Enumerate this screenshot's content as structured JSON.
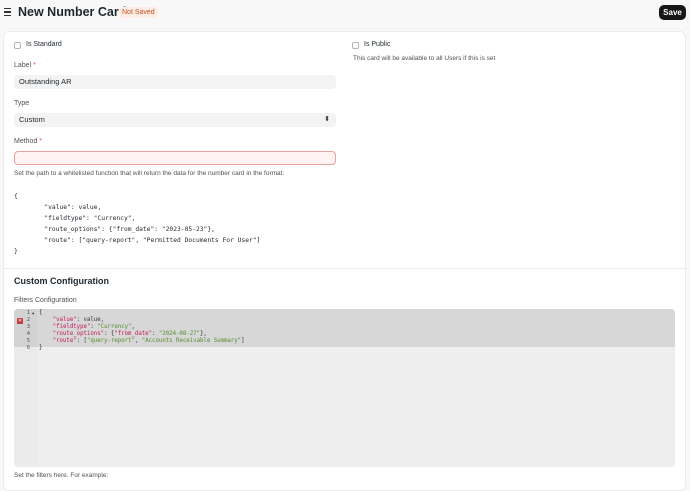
{
  "header": {
    "title": "New Number Card",
    "status_badge": "Not Saved",
    "save_label": "Save"
  },
  "form": {
    "is_standard_label": "Is Standard",
    "is_public_label": "Is Public",
    "is_public_help": "This card will be available to all Users if this is set",
    "label_label": "Label",
    "label_value": "Outstanding AR",
    "type_label": "Type",
    "type_value": "Custom",
    "method_label": "Method",
    "method_value": "",
    "method_help": "Set the path to a whitelisted function that will return the data for the number card in the format:",
    "method_example": "{\n        \"value\": value,\n        \"fieldtype\": \"Currency\",\n        \"route_options\": {\"from_date\": \"2023-05-23\"},\n        \"route\": [\"query-report\", \"Permitted Documents For User\"]\n}"
  },
  "custom_config": {
    "section_title": "Custom Configuration",
    "filters_label": "Filters Configuration",
    "editor_lines": [
      {
        "no": "1",
        "text": "{"
      },
      {
        "no": "2",
        "key": "\"value\"",
        "rest": ": value,"
      },
      {
        "no": "3",
        "key": "\"fieldtype\"",
        "rest": ": ",
        "str": "\"Currency\"",
        "tail": ","
      },
      {
        "no": "4",
        "key": "\"route_options\"",
        "rest": ": {",
        "key2": "\"from_date\"",
        "rest2": ": ",
        "str": "\"2024-08-27\"",
        "tail": "},"
      },
      {
        "no": "5",
        "key": "\"route\"",
        "rest": ": [",
        "str": "\"query-report\"",
        "mid": ", ",
        "str2": "\"Accounts Receivable Summary\"",
        "tail": "]"
      },
      {
        "no": "6",
        "text": "}"
      }
    ],
    "bottom_help": "Set the filters here. For example:"
  },
  "colors": {
    "accent": "#171717",
    "badge_bg": "#fdece6",
    "badge_text": "#c5531c",
    "required": "#e24c4c",
    "code_key": "#c2185b",
    "code_string": "#558b2f"
  },
  "icons": [
    "menu-icon",
    "select-arrows-icon",
    "error-marker-icon",
    "fold-arrow-icon"
  ]
}
